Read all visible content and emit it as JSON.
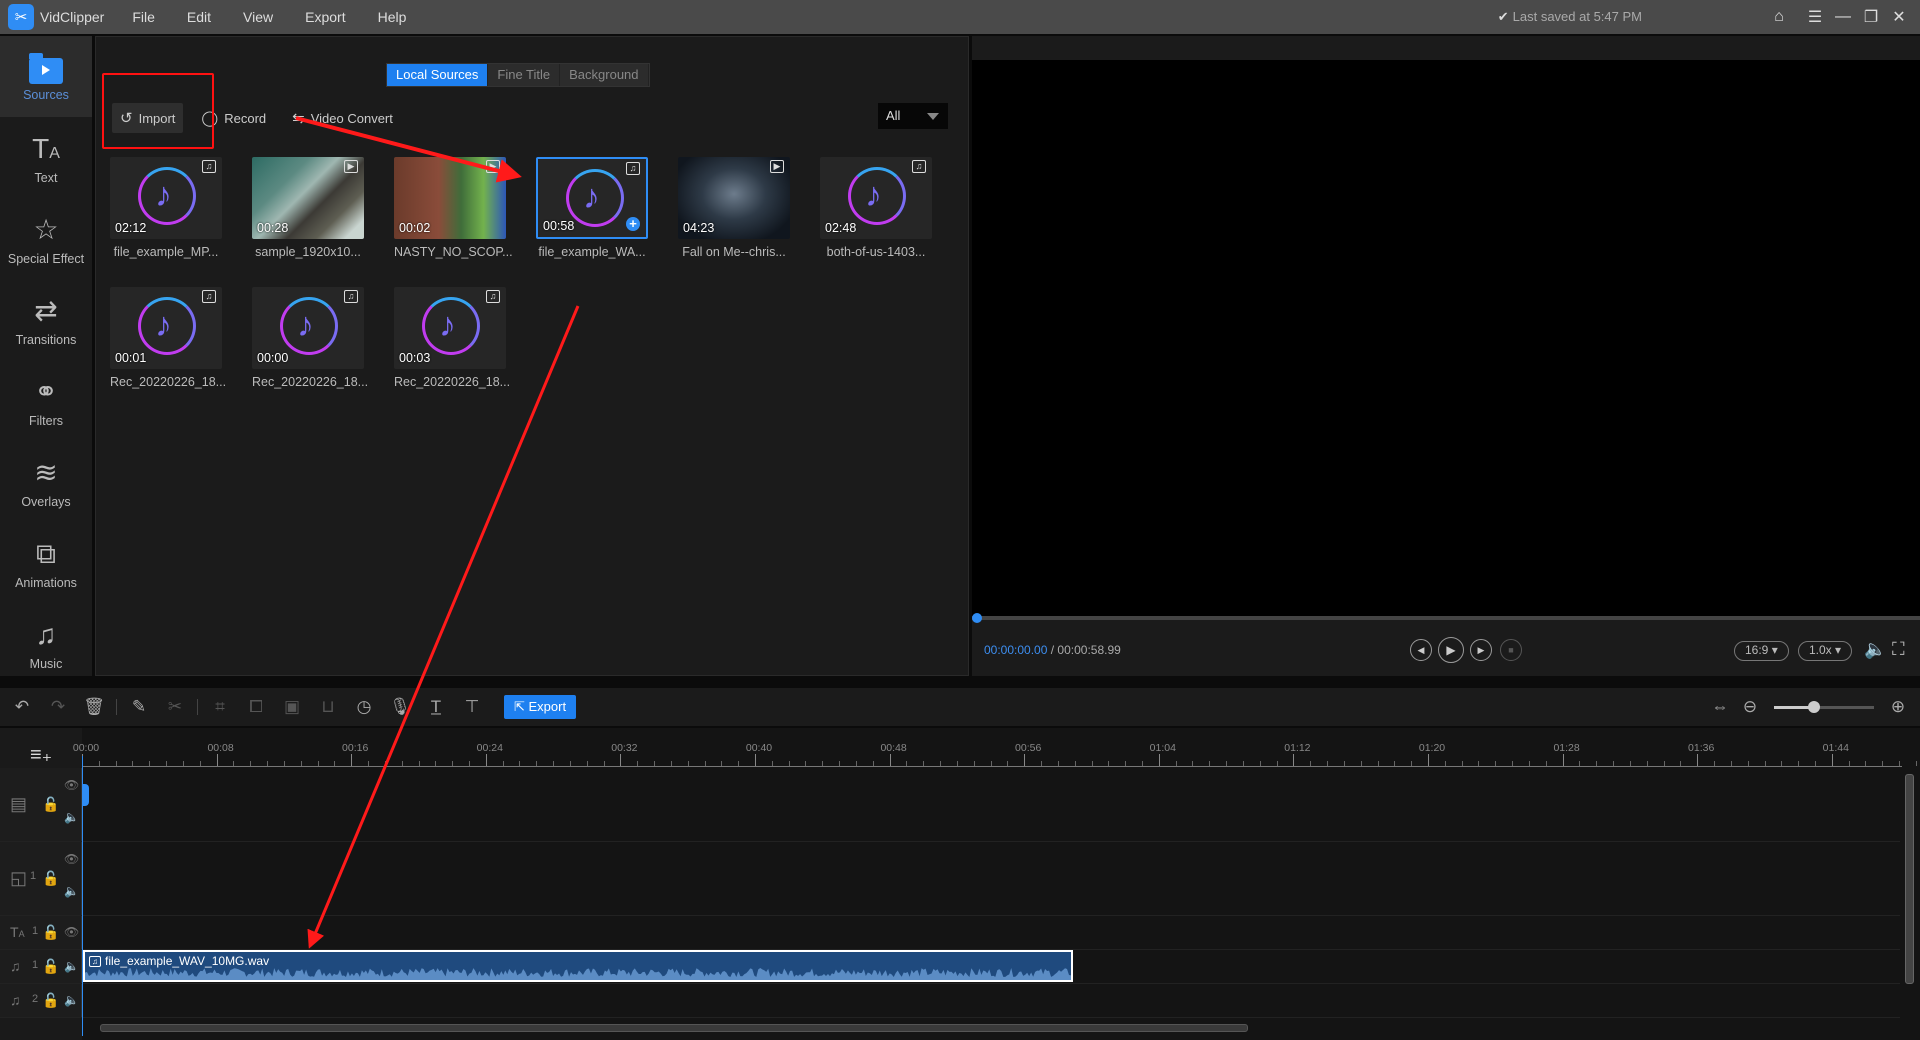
{
  "app": {
    "name": "VidClipper",
    "menu": [
      "File",
      "Edit",
      "View",
      "Export",
      "Help"
    ],
    "last_saved": "Last saved at 5:47 PM",
    "window_controls": [
      "home-icon",
      "menu-icon",
      "minimize-icon",
      "maximize-icon",
      "close-icon"
    ]
  },
  "sidebar": {
    "items": [
      {
        "label": "Sources",
        "icon": "folder-play-icon",
        "active": true
      },
      {
        "label": "Text",
        "icon": "text-icon"
      },
      {
        "label": "Special Effect",
        "icon": "sparkle-star-icon"
      },
      {
        "label": "Transitions",
        "icon": "transition-arrows-icon"
      },
      {
        "label": "Filters",
        "icon": "filters-circles-icon"
      },
      {
        "label": "Overlays",
        "icon": "layers-icon"
      },
      {
        "label": "Animations",
        "icon": "animation-icon"
      },
      {
        "label": "Music",
        "icon": "music-note-icon"
      }
    ]
  },
  "media": {
    "tabs": [
      {
        "label": "Local Sources",
        "active": true
      },
      {
        "label": "Fine Title"
      },
      {
        "label": "Background"
      }
    ],
    "toolbar": {
      "import": "Import",
      "record": "Record",
      "video_convert": "Video Convert"
    },
    "filter": {
      "selected": "All"
    },
    "items": [
      {
        "name": "file_example_MP...",
        "duration": "02:12",
        "type": "audio"
      },
      {
        "name": "sample_1920x10...",
        "duration": "00:28",
        "type": "video"
      },
      {
        "name": "NASTY_NO_SCOP...",
        "duration": "00:02",
        "type": "video"
      },
      {
        "name": "file_example_WA...",
        "duration": "00:58",
        "type": "audio",
        "selected": true
      },
      {
        "name": "Fall on Me--chris...",
        "duration": "04:23",
        "type": "video"
      },
      {
        "name": "both-of-us-1403...",
        "duration": "02:48",
        "type": "audio"
      },
      {
        "name": "Rec_20220226_18...",
        "duration": "00:01",
        "type": "audio"
      },
      {
        "name": "Rec_20220226_18...",
        "duration": "00:00",
        "type": "audio"
      },
      {
        "name": "Rec_20220226_18...",
        "duration": "00:03",
        "type": "audio"
      }
    ]
  },
  "preview": {
    "current_time": "00:00:00.00",
    "separator": " / ",
    "total_time": "00:00:58.99",
    "aspect": "16:9",
    "speed": "1.0x",
    "progress": 0
  },
  "timeline": {
    "export_label": "Export",
    "zoom_level": 0.4,
    "ruler": [
      "00:00",
      "00:08",
      "00:16",
      "00:24",
      "00:32",
      "00:40",
      "00:48",
      "00:56",
      "01:04",
      "01:12",
      "01:20",
      "01:28",
      "01:36",
      "01:44"
    ],
    "tracks": [
      {
        "type": "video",
        "index": ""
      },
      {
        "type": "overlay",
        "index": "1"
      },
      {
        "type": "text",
        "index": "1"
      },
      {
        "type": "music",
        "index": "1"
      },
      {
        "type": "music",
        "index": "2"
      }
    ],
    "clip": {
      "name": "file_example_WAV_10MG.wav",
      "track": "music-1"
    }
  },
  "colors": {
    "accent": "#1e80f0",
    "annotation": "#ff1a1a",
    "titlebar": "#4a4a4a"
  }
}
